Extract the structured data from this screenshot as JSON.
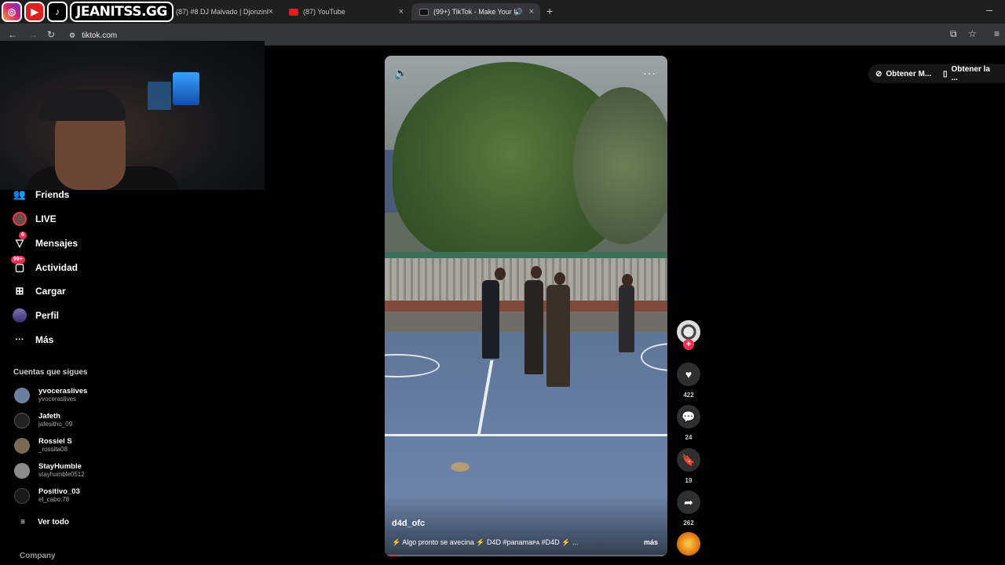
{
  "browser": {
    "tabs": [
      {
        "label": "(87) #8 DJ Malvado | Djonzinho",
        "color": "#e02020"
      },
      {
        "label": "(87) YouTube",
        "color": "#e02020"
      },
      {
        "label": "(99+) TikTok - Make Your Da",
        "color": "#111111",
        "active": true
      }
    ],
    "close_glyph": "×",
    "new_tab_glyph": "+",
    "minimize_glyph": "–",
    "url": "tiktok.com"
  },
  "overlay": {
    "handle": "JEANITSS.GG",
    "icons": [
      "instagram-icon",
      "youtube-icon",
      "tiktok-icon"
    ]
  },
  "sidebar": {
    "items": [
      {
        "label": "Friends",
        "icon": "friends-icon",
        "glyph": "👥"
      },
      {
        "label": "LIVE",
        "icon": "live-icon",
        "glyph": "●"
      },
      {
        "label": "Mensajes",
        "icon": "messages-icon",
        "glyph": "▽",
        "badge": "6"
      },
      {
        "label": "Actividad",
        "icon": "activity-icon",
        "glyph": "▢",
        "badge": "99+"
      },
      {
        "label": "Cargar",
        "icon": "upload-icon",
        "glyph": "⊞"
      },
      {
        "label": "Perfil",
        "icon": "profile-icon",
        "glyph": "◉"
      },
      {
        "label": "Más",
        "icon": "more-icon",
        "glyph": "···"
      }
    ],
    "following_title": "Cuentas que sigues",
    "following": [
      {
        "name": "yvoceraslives",
        "username": "yvoceraslives",
        "color": "#6d7fa0"
      },
      {
        "name": "Jafeth",
        "username": "jafesitho_09",
        "color": "#222222"
      },
      {
        "name": "Rossiel S",
        "username": "_rossita08",
        "color": "#7a6a55"
      },
      {
        "name": "StayHumble",
        "username": "stayhumble0512",
        "color": "#8a8a8a"
      },
      {
        "name": "Positivo_03",
        "username": "el_cabo.78",
        "color": "#1a1a1a"
      }
    ],
    "see_all": "Ver todo",
    "company": "Company"
  },
  "video": {
    "username": "d4d_ofc",
    "caption": "⚡ Algo pronto se avecina ⚡ D4D #panamaᴘᴀ #D4D ⚡ ...",
    "more_label": "más",
    "progress": 0.05
  },
  "actions": {
    "likes": "422",
    "comments": "24",
    "saves": "19",
    "shares": "262"
  },
  "get_app": [
    {
      "label": "Obtener M...",
      "icon": "link-icon"
    },
    {
      "label": "Obtener la ...",
      "icon": "phone-icon"
    }
  ]
}
